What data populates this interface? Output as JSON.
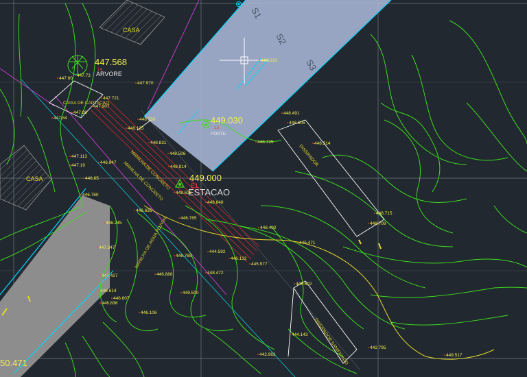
{
  "colors": {
    "background": "#212830",
    "grid": "#6f7882",
    "road_fill": "#a9b6d6",
    "road_edge": "#00d7ff",
    "contour": "#3fdc1e",
    "contour_bold": "#e6d92a",
    "elevation": "#f3f04a",
    "point_code": "#ff3c3c",
    "hatched_edge": "#9a9a9a",
    "crosshair": "#ffffff",
    "magenta": "#d43fd8",
    "cyan_line": "#10b8c8"
  },
  "map": {
    "buildings": [
      {
        "label": "CASA"
      },
      {
        "label": "CASA"
      }
    ],
    "road_sections": [
      "S1",
      "S2",
      "S3"
    ],
    "stations": [
      {
        "elevation": "447.568",
        "point": "14",
        "name": "ARVORE",
        "icon": "tree-icon"
      },
      {
        "elevation": "449.030",
        "point": "15",
        "name": "POSTE",
        "icon": "target-icon"
      },
      {
        "elevation": "449.000",
        "point": "E1",
        "name": "ESTACAO",
        "icon": "station-triangle-icon"
      }
    ],
    "bottom_left_value": "50.471",
    "structure_labels": [
      "CAIXA DE CAPTACAO",
      "MANILHA DE CONCRETO",
      "MANILHA DE CONCRETO",
      "MANILHA DE AGUA PLUVIAL",
      "DISSIPADOR",
      "DISSIPADOR SANIFICADO"
    ],
    "spot_elevations": [
      "447.970",
      "447.60",
      "447.73",
      "447.721",
      "447.907",
      "447.88",
      "447.84",
      "448.750",
      "448.135",
      "448.831",
      "448.506",
      "448.914",
      "446.947",
      "447.113",
      "447.19",
      "446.65",
      "448.622",
      "448.848",
      "446.765",
      "448.635",
      "446.245",
      "447.347",
      "447.427",
      "446.614",
      "446.607",
      "446.836",
      "446.760",
      "446.106",
      "449.500",
      "448.402",
      "445.471",
      "444.592",
      "446.132",
      "445.977",
      "446.768",
      "448.472",
      "446.886",
      "448.491",
      "448.505",
      "448.725",
      "448.514",
      "448.715",
      "448.709",
      "448.602",
      "444.143",
      "442.795",
      "442.963",
      "448.519",
      "449.517"
    ]
  }
}
